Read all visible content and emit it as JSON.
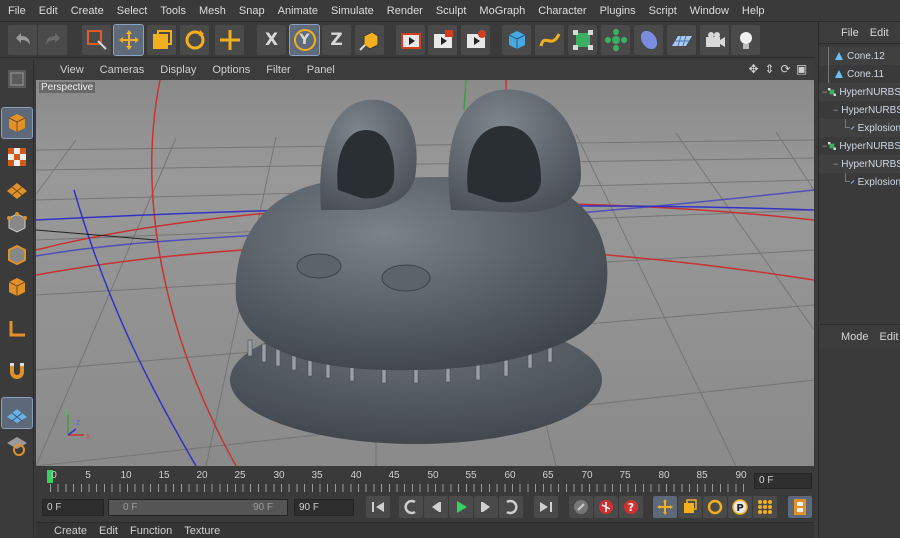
{
  "menubar": {
    "items": [
      "File",
      "Edit",
      "Create",
      "Select",
      "Tools",
      "Mesh",
      "Snap",
      "Animate",
      "Simulate",
      "Render",
      "Sculpt",
      "MoGraph",
      "Character",
      "Plugins",
      "Script",
      "Window",
      "Help"
    ]
  },
  "toolbar": {
    "axis_x": "X",
    "axis_y": "Y",
    "axis_z": "Z",
    "icons": [
      "undo-icon",
      "redo-icon",
      "live-select-icon",
      "move-icon",
      "scale-icon",
      "rotate-icon",
      "last-tool-icon",
      "x-axis-icon",
      "y-axis-icon",
      "z-axis-icon",
      "coordinate-system-icon",
      "render-view-icon",
      "render-picture-viewer-icon",
      "render-settings-icon",
      "cube-icon",
      "spline-icon",
      "subdivision-icon",
      "cloner-icon",
      "deformer-icon",
      "floor-icon",
      "camera-icon",
      "light-icon"
    ]
  },
  "viewport": {
    "menu": [
      "View",
      "Cameras",
      "Display",
      "Options",
      "Filter",
      "Panel"
    ],
    "label": "Perspective",
    "axis_labels": {
      "x": "x",
      "y": "y",
      "z": "z"
    }
  },
  "timeline": {
    "ticks": [
      "0",
      "5",
      "10",
      "15",
      "20",
      "25",
      "30",
      "35",
      "40",
      "45",
      "50",
      "55",
      "60",
      "65",
      "70",
      "75",
      "80",
      "85",
      "90"
    ],
    "current_frame": "0 F"
  },
  "playback": {
    "start_field": "0 F",
    "range_start": "0 F",
    "range_end": "90 F",
    "end_field": "90 F"
  },
  "material_panel": {
    "menu": [
      "Create",
      "Edit",
      "Function",
      "Texture"
    ]
  },
  "objects_panel": {
    "menu": [
      "File",
      "Edit"
    ],
    "items": [
      {
        "name": "Cone.12",
        "icon": "cone-icon",
        "indent": 0
      },
      {
        "name": "Cone.11",
        "icon": "cone-icon",
        "indent": 0
      },
      {
        "name": "HyperNURBS",
        "icon": "hypernurbs-icon",
        "indent": 0
      },
      {
        "name": "HyperNURBS",
        "icon": "cone-icon",
        "indent": 1
      },
      {
        "name": "Explosion",
        "icon": "explosion-icon",
        "indent": 2
      },
      {
        "name": "HyperNURBS",
        "icon": "hypernurbs-icon",
        "indent": 0
      },
      {
        "name": "HyperNURBS",
        "icon": "cone-icon",
        "indent": 1
      },
      {
        "name": "Explosion",
        "icon": "explosion-icon",
        "indent": 2
      }
    ]
  },
  "attributes_panel": {
    "menu": [
      "Mode",
      "Edit"
    ]
  },
  "colors": {
    "viewport_bg": "#8c8c8c",
    "model_gray": "#5a6168",
    "accent_blue": "#5d6878",
    "x_axis": "#c83232",
    "y_axis": "#3ca03c",
    "z_axis": "#3232c8"
  }
}
